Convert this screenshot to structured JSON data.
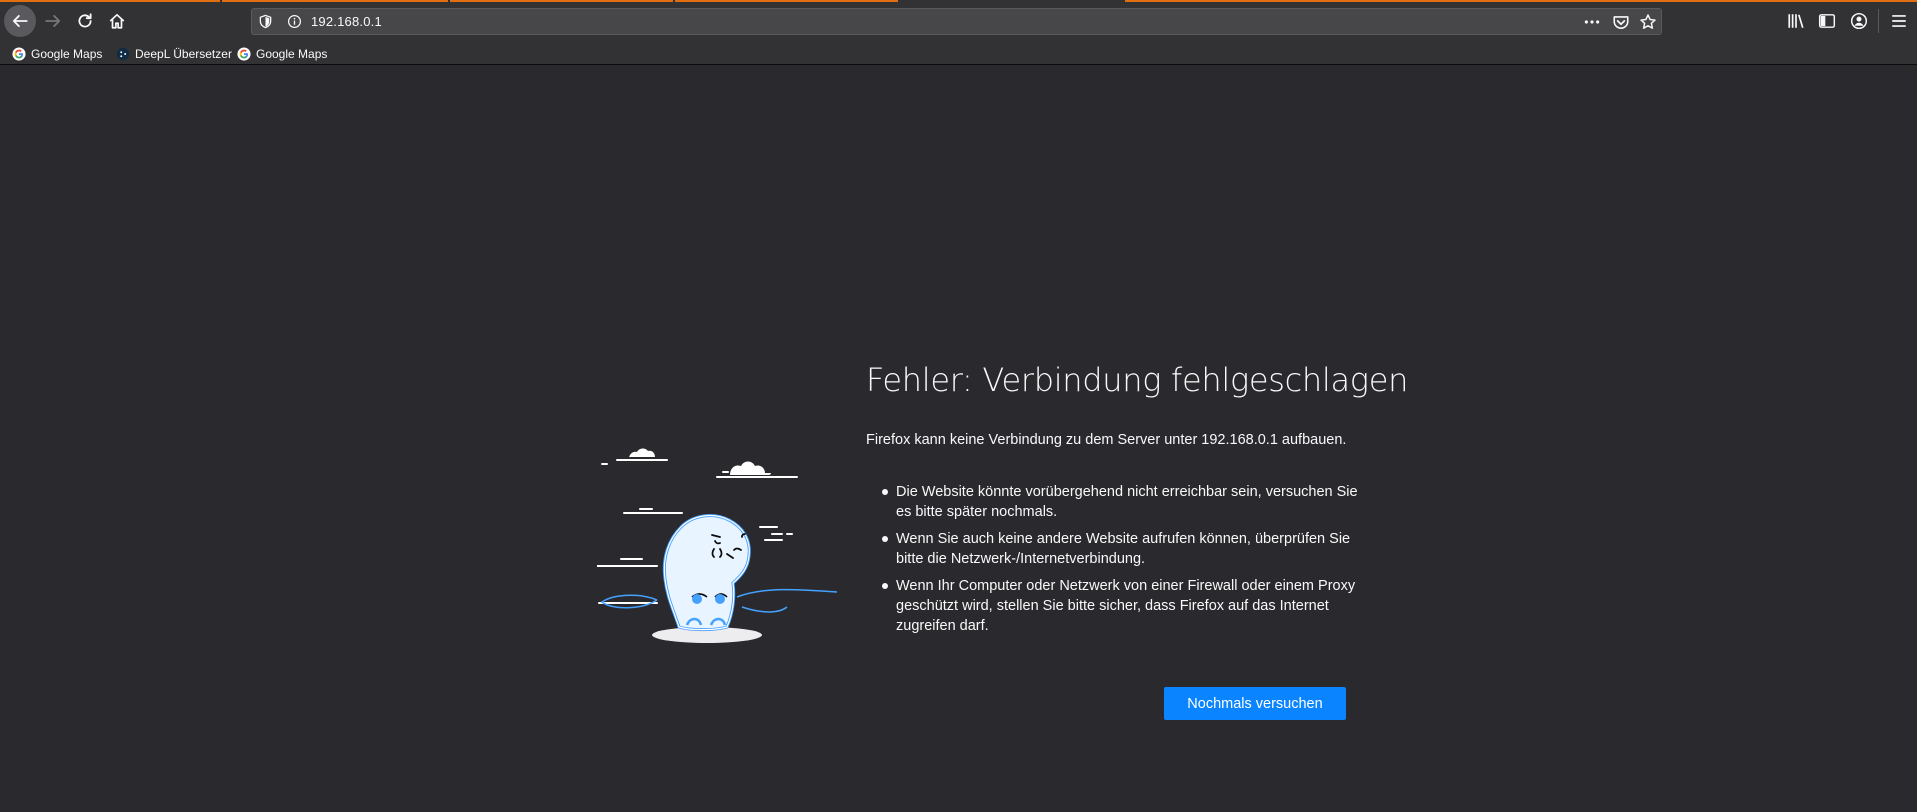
{
  "theme": {
    "accent": "#0a84ff",
    "tab_line": "#e16f12",
    "background": "#2a2a2e",
    "toolbar": "#323234"
  },
  "toolbar": {
    "back": "back-arrow-icon",
    "forward": "forward-arrow-icon",
    "reload": "reload-icon",
    "home": "home-icon",
    "right_icons": [
      "library-icon",
      "sidebar-icon",
      "account-icon",
      "hamburger-menu-icon"
    ]
  },
  "urlbar": {
    "url": "192.168.0.1",
    "icons": [
      "shield-icon",
      "info-icon",
      "more-actions-icon",
      "pocket-icon",
      "bookmark-star-icon"
    ]
  },
  "bookmarks": [
    {
      "label": "Google Maps",
      "icon": "google-icon"
    },
    {
      "label": "DeepL Übersetzer",
      "icon": "deepl-icon"
    },
    {
      "label": "Google Maps",
      "icon": "google-icon"
    }
  ],
  "error": {
    "title": "Fehler: Verbindung fehlgeschlagen",
    "description": "Firefox kann keine Verbindung zu dem Server unter 192.168.0.1 aufbauen.",
    "items": [
      "Die Website könnte vorübergehend nicht erreichbar sein, versuchen Sie es bitte später nochmals.",
      "Wenn Sie auch keine andere Website aufrufen können, überprüfen Sie bitte die Netzwerk-/Internetverbindung.",
      "Wenn Ihr Computer oder Netzwerk von einer Firewall oder einem Proxy geschützt wird, stellen Sie bitte sicher, dass Firefox auf das Internet zugreifen darf."
    ],
    "retry_label": "Nochmals versuchen"
  }
}
